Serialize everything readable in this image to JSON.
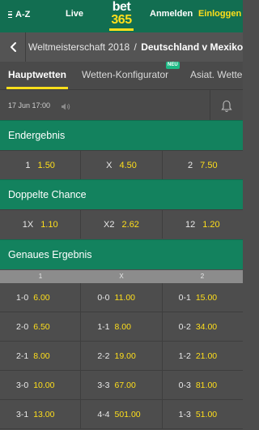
{
  "header": {
    "az_label": "A-Z",
    "live_label": "Live",
    "logo_line1": "bet",
    "logo_line2": "365",
    "login_label": "Anmelden",
    "register_label": "Einloggen"
  },
  "breadcrumb": {
    "league": "Weltmeisterschaft 2018",
    "separator": "/",
    "match": "Deutschland v Mexiko"
  },
  "tabs": [
    {
      "label": "Hauptwetten",
      "active": true
    },
    {
      "label": "Wetten-Konfigurator",
      "active": false
    },
    {
      "label": "Asiat. Wetten",
      "active": false
    }
  ],
  "new_badge": "NEU",
  "event_info": {
    "datetime": "17 Jun 17:00"
  },
  "markets": {
    "endergebnis": {
      "title": "Endergebnis",
      "selections": [
        {
          "label": "1",
          "price": "1.50"
        },
        {
          "label": "X",
          "price": "4.50"
        },
        {
          "label": "2",
          "price": "7.50"
        }
      ]
    },
    "doppelte_chance": {
      "title": "Doppelte Chance",
      "selections": [
        {
          "label": "1X",
          "price": "1.10"
        },
        {
          "label": "X2",
          "price": "2.62"
        },
        {
          "label": "12",
          "price": "1.20"
        }
      ]
    },
    "genaues_ergebnis": {
      "title": "Genaues Ergebnis",
      "columns": [
        "1",
        "X",
        "2"
      ],
      "rows": [
        [
          {
            "score": "1-0",
            "price": "6.00"
          },
          {
            "score": "0-0",
            "price": "11.00"
          },
          {
            "score": "0-1",
            "price": "15.00"
          }
        ],
        [
          {
            "score": "2-0",
            "price": "6.50"
          },
          {
            "score": "1-1",
            "price": "8.00"
          },
          {
            "score": "0-2",
            "price": "34.00"
          }
        ],
        [
          {
            "score": "2-1",
            "price": "8.00"
          },
          {
            "score": "2-2",
            "price": "19.00"
          },
          {
            "score": "1-2",
            "price": "21.00"
          }
        ],
        [
          {
            "score": "3-0",
            "price": "10.00"
          },
          {
            "score": "3-3",
            "price": "67.00"
          },
          {
            "score": "0-3",
            "price": "81.00"
          }
        ],
        [
          {
            "score": "3-1",
            "price": "13.00"
          },
          {
            "score": "4-4",
            "price": "501.00"
          },
          {
            "score": "1-3",
            "price": "51.00"
          }
        ]
      ]
    }
  },
  "colors": {
    "brand_green": "#126e51",
    "section_green": "#13825e",
    "accent_yellow": "#ffdf1b",
    "background": "#4d4d4d"
  }
}
